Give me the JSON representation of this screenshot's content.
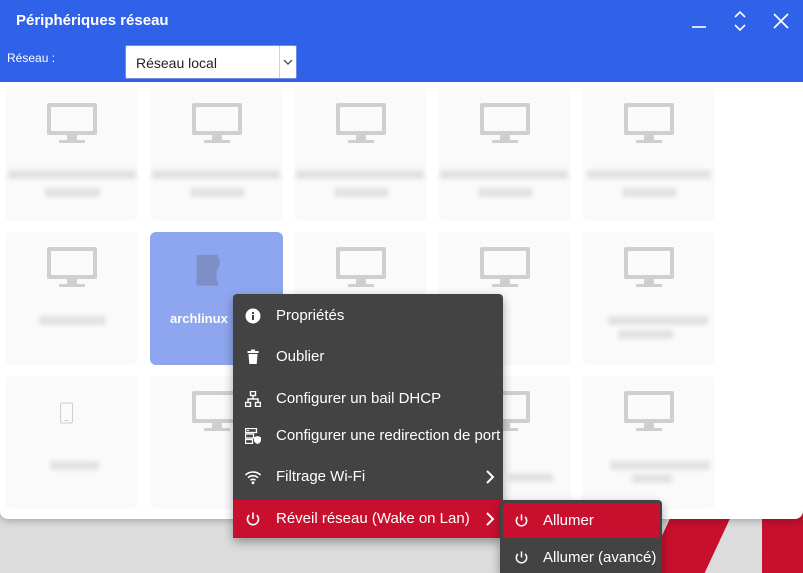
{
  "window": {
    "title": "Périphériques réseau",
    "network_label": "Réseau :",
    "network_value": "Réseau local"
  },
  "devices": [
    {
      "icon": "desktop-computer-icon",
      "name": ""
    },
    {
      "icon": "desktop-computer-icon",
      "name": ""
    },
    {
      "icon": "desktop-computer-icon",
      "name": ""
    },
    {
      "icon": "desktop-computer-icon",
      "name": ""
    },
    {
      "icon": "desktop-computer-icon",
      "name": ""
    },
    {
      "icon": "desktop-computer-icon",
      "name": ""
    },
    {
      "icon": "tower-computer-icon",
      "name": "archlinux",
      "selected": true
    },
    {
      "icon": "desktop-computer-icon",
      "name": ""
    },
    {
      "icon": "desktop-computer-icon",
      "name": ""
    },
    {
      "icon": "desktop-computer-icon",
      "name": ""
    },
    {
      "icon": "smartphone-icon",
      "name": ""
    },
    {
      "icon": "desktop-computer-icon",
      "name": ""
    },
    {
      "icon": "desktop-computer-icon",
      "name": ""
    },
    {
      "icon": "desktop-computer-icon",
      "name": ""
    },
    {
      "icon": "desktop-computer-icon",
      "name": ""
    }
  ],
  "context_menu": {
    "items": [
      {
        "icon": "info-icon",
        "label": "Propriétés"
      },
      {
        "icon": "trash-icon",
        "label": "Oublier"
      },
      {
        "icon": "network-topology-icon",
        "label": "Configurer un bail DHCP"
      },
      {
        "icon": "server-shield-icon",
        "label": "Configurer une redirection de port"
      },
      {
        "icon": "wifi-icon",
        "label": "Filtrage Wi-Fi"
      },
      {
        "icon": "power-icon",
        "label": "Réveil réseau (Wake on Lan)"
      }
    ]
  },
  "submenu": {
    "items": [
      {
        "icon": "power-icon",
        "label": "Allumer"
      },
      {
        "icon": "power-icon",
        "label": "Allumer (avancé)"
      }
    ]
  },
  "colors": {
    "titlebar": "#2f62e9",
    "menu_bg": "#434343",
    "accent_red": "#c8102e",
    "selected_tile": "#8ea6ef"
  }
}
